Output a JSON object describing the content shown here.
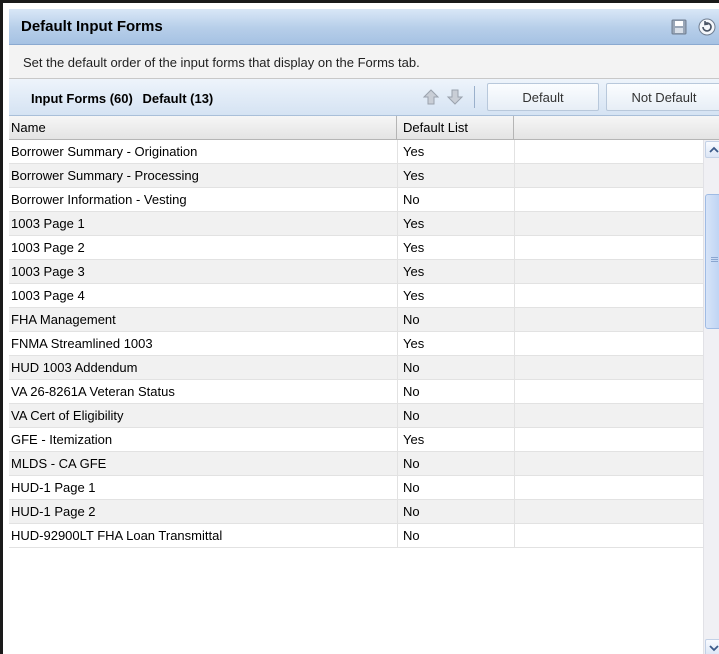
{
  "window": {
    "title": "Default Input Forms"
  },
  "titlebar": {
    "save_icon": "save-icon",
    "refresh_icon": "refresh-icon"
  },
  "description": "Set the default order of the input forms that display on the Forms tab.",
  "toolbar": {
    "input_forms_label": "Input Forms (60)",
    "default_count_label": "Default (13)",
    "move_up_icon": "arrow-up-icon",
    "move_down_icon": "arrow-down-icon",
    "default_button": "Default",
    "not_default_button": "Not Default"
  },
  "columns": {
    "name": "Name",
    "default_list": "Default List"
  },
  "rows": [
    {
      "name": "Borrower Summary - Origination",
      "default": "Yes"
    },
    {
      "name": "Borrower Summary - Processing",
      "default": "Yes"
    },
    {
      "name": "Borrower Information - Vesting",
      "default": "No"
    },
    {
      "name": "1003 Page 1",
      "default": "Yes"
    },
    {
      "name": "1003 Page 2",
      "default": "Yes"
    },
    {
      "name": "1003 Page 3",
      "default": "Yes"
    },
    {
      "name": "1003 Page 4",
      "default": "Yes"
    },
    {
      "name": "FHA Management",
      "default": "No"
    },
    {
      "name": "FNMA Streamlined 1003",
      "default": "Yes"
    },
    {
      "name": "HUD 1003 Addendum",
      "default": "No"
    },
    {
      "name": "VA 26-8261A Veteran Status",
      "default": "No"
    },
    {
      "name": "VA Cert of Eligibility",
      "default": "No"
    },
    {
      "name": "GFE - Itemization",
      "default": "Yes"
    },
    {
      "name": "MLDS - CA GFE",
      "default": "No"
    },
    {
      "name": "HUD-1 Page 1",
      "default": "No"
    },
    {
      "name": "HUD-1 Page 2",
      "default": "No"
    },
    {
      "name": "HUD-92900LT FHA Loan Transmittal",
      "default": "No"
    }
  ],
  "colors": {
    "title_bar": "#b6cee9",
    "toolbar": "#d5e3f3",
    "row_alt": "#f1f1f1"
  }
}
